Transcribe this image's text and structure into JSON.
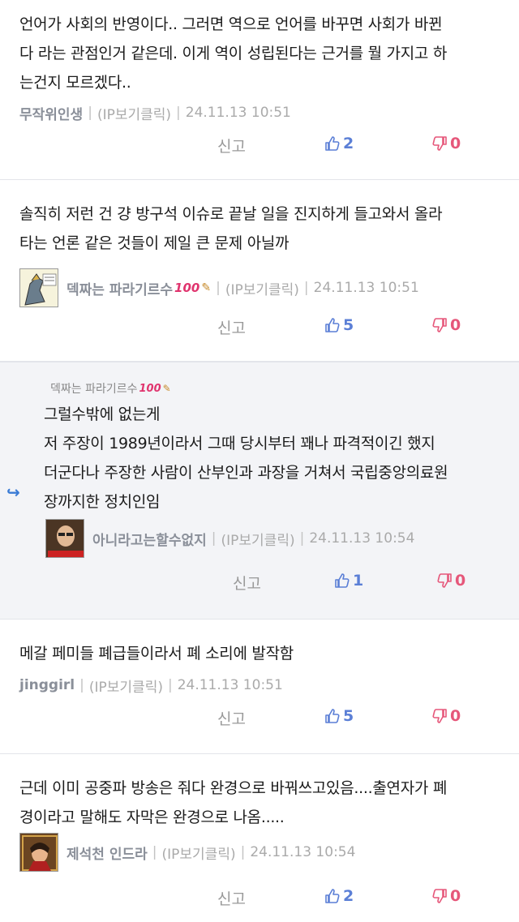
{
  "comments": [
    {
      "text": "언어가 사회의 반영이다.. 그러면 역으로 언어를 바꾸면 사회가 바뀐\n다 라는 관점인거 같은데. 이게 역이 성립된다는 근거를 뭘 가지고 하\n는건지 모르겠다..",
      "nick": "무작위인생",
      "ip": "(IP보기클릭)",
      "time": "24.11.13 10:51",
      "report": "신고",
      "likes": "2",
      "dislikes": "0"
    },
    {
      "text": "솔직히 저런 건 걍 방구석 이슈로 끝날 일을 진지하게 들고와서 올라\n타는 언론 같은 것들이 제일 큰 문제 아닐까",
      "nick": "덱짜는 파라기르수",
      "badge": "100",
      "ip": "(IP보기클릭)",
      "time": "24.11.13 10:51",
      "report": "신고",
      "likes": "5",
      "dislikes": "0"
    },
    {
      "reply_to": "덱짜는 파라기르수",
      "reply_badge": "100",
      "text": "그럴수밖에 없는게\n저 주장이 1989년이라서 그때 당시부터 꽤나 파격적이긴 했지\n더군다나 주장한 사람이 산부인과 과장을 거쳐서 국립중앙의료원\n장까지한 정치인임",
      "nick": "아니라고는할수없지",
      "ip": "(IP보기클릭)",
      "time": "24.11.13 10:54",
      "report": "신고",
      "likes": "1",
      "dislikes": "0"
    },
    {
      "text": "메갈 페미들 폐급들이라서 폐 소리에 발작함",
      "nick": "jinggirl",
      "ip": "(IP보기클릭)",
      "time": "24.11.13 10:51",
      "report": "신고",
      "likes": "5",
      "dislikes": "0"
    },
    {
      "text": "근데 이미 공중파 방송은 줘다 완경으로 바꿔쓰고있음....출연자가 폐\n경이라고 말해도 자막은 완경으로 나옴.....",
      "nick": "제석천 인드라",
      "ip": "(IP보기클릭)",
      "time": "24.11.13 10:54",
      "report": "신고",
      "likes": "2",
      "dislikes": "0"
    }
  ],
  "colors": {
    "like": "#5b7fd6",
    "dislike": "#e6577a",
    "reply_bg": "#f3f4f7"
  }
}
